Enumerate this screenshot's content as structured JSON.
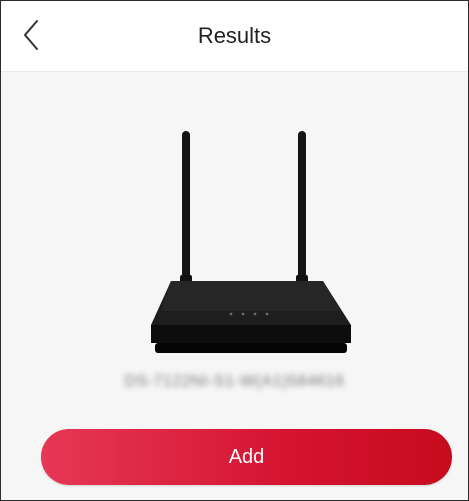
{
  "header": {
    "title": "Results",
    "back_icon": "chevron-left-icon"
  },
  "device": {
    "image": "router-image",
    "serial_blurred": "DS-7122NI-S1-W(A1)584616"
  },
  "actions": {
    "add_label": "Add"
  },
  "colors": {
    "accent_start": "#e53856",
    "accent_end": "#c70b1e",
    "background": "#f6f6f6",
    "header_bg": "#ffffff"
  }
}
